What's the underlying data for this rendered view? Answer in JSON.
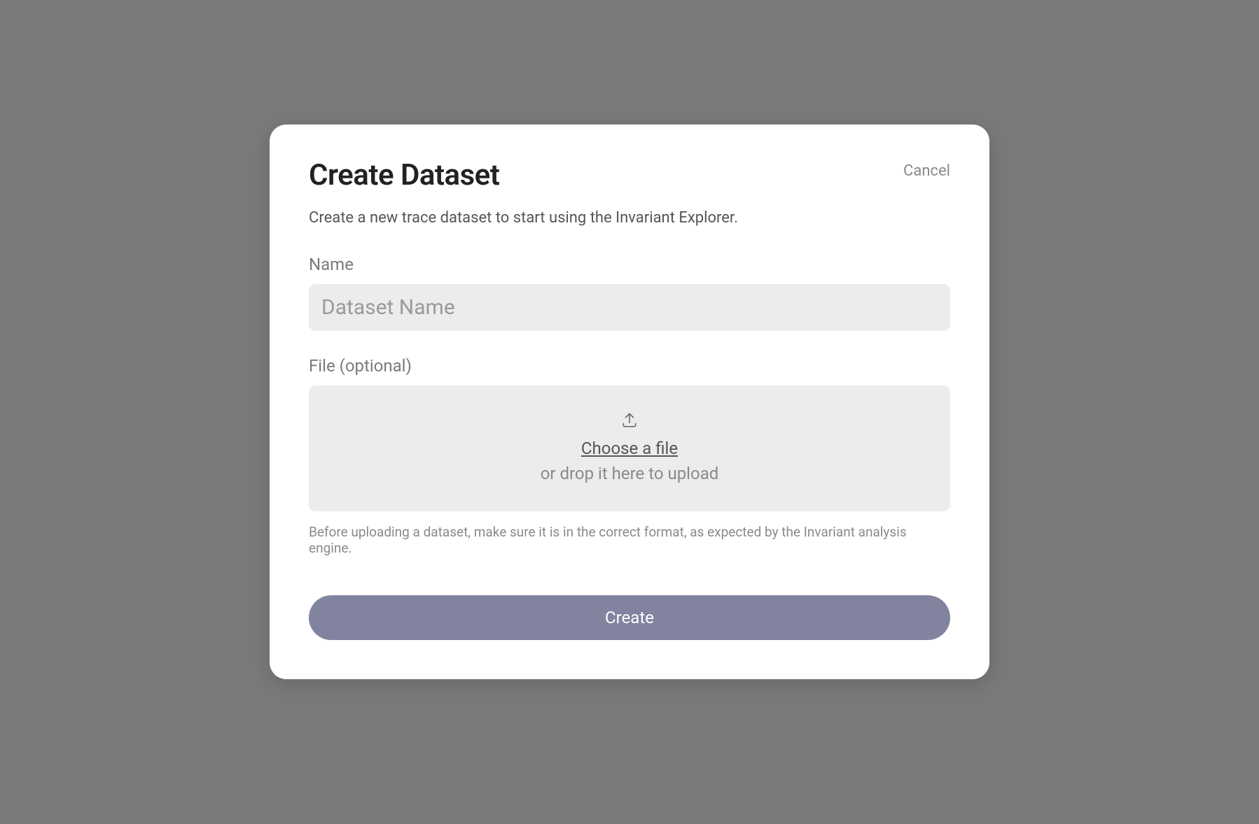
{
  "modal": {
    "title": "Create Dataset",
    "cancel_label": "Cancel",
    "description": "Create a new trace dataset to start using the Invariant Explorer.",
    "name_field": {
      "label": "Name",
      "placeholder": "Dataset Name",
      "value": ""
    },
    "file_field": {
      "label": "File (optional)",
      "choose_file_label": "Choose a file",
      "drop_text": "or drop it here to upload"
    },
    "helper_text": "Before uploading a dataset, make sure it is in the correct format, as expected by the Invariant analysis engine.",
    "create_button_label": "Create"
  }
}
